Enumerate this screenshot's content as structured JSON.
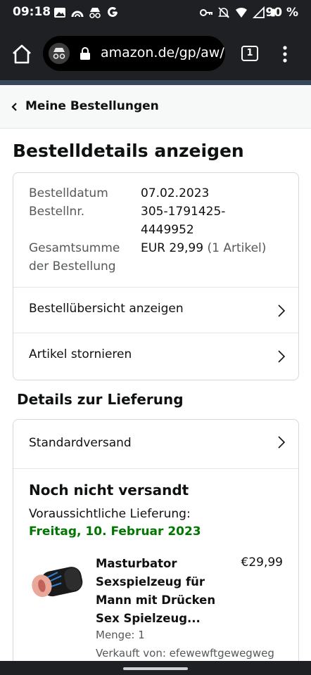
{
  "status_bar": {
    "time": "09:18",
    "battery": "90 %",
    "left_icons": [
      "image-icon",
      "arc-icon",
      "incognito-icon",
      "google-icon"
    ],
    "right_icons": [
      "key-icon",
      "bell-off-icon",
      "wifi-icon",
      "signal-icon",
      "battery-icon"
    ]
  },
  "browser": {
    "url": "amazon.de/gp/aw/",
    "tab_count": "1"
  },
  "breadcrumb": {
    "label": "Meine Bestellungen"
  },
  "page": {
    "title": "Bestelldetails anzeigen"
  },
  "order_summary": {
    "date_label": "Bestelldatum",
    "date_value": "07.02.2023",
    "number_label": "Bestellnr.",
    "number_value_line1": "305-1791425-",
    "number_value_line2": "4449952",
    "total_label_line1": "Gesamtsumme",
    "total_label_line2": "der Bestellung",
    "total_value": "EUR 29,99",
    "total_items": "(1 Artikel)",
    "actions": [
      "Bestellübersicht anzeigen",
      "Artikel stornieren"
    ]
  },
  "delivery": {
    "section_title": "Details zur Lieferung",
    "shipping_method": "Standardversand",
    "status": "Noch nicht versandt",
    "expected_label": "Voraussichtliche Lieferung:",
    "expected_date": "Freitag, 10. Februar 2023"
  },
  "item": {
    "title_lines": [
      "Masturbator",
      "Sexspielzeug für",
      "Mann mit Drücken",
      "Sex Spielzeug..."
    ],
    "price": "€29,99",
    "quantity": "Menge: 1",
    "seller": "Verkauft von: efewewftgewegweg"
  },
  "colors": {
    "header_bg": "#1f2023",
    "delivery_green": "#007600",
    "amazon_strip": "#37475a"
  }
}
